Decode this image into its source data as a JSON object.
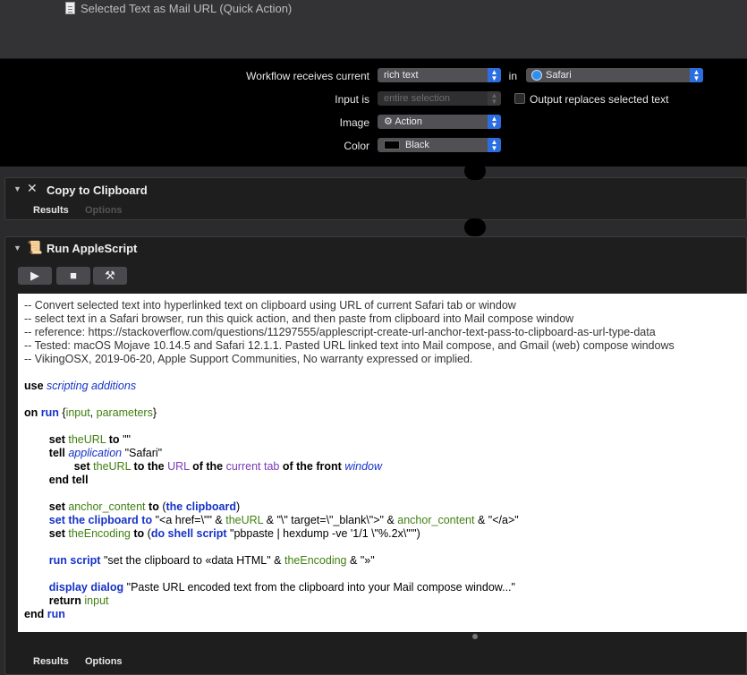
{
  "window": {
    "title": "Selected Text as Mail URL (Quick Action)"
  },
  "settings": {
    "receives_label": "Workflow receives current",
    "receives_value": "rich text",
    "in_label": "in",
    "app_value": "Safari",
    "input_label": "Input is",
    "input_value": "entire selection",
    "output_replaces_label": "Output replaces selected text",
    "image_label": "Image",
    "image_value": "Action",
    "color_label": "Color",
    "color_value": "Black"
  },
  "actions": {
    "copy": {
      "name": "Copy to Clipboard",
      "results_tab": "Results",
      "options_tab": "Options"
    },
    "script": {
      "name": "Run AppleScript",
      "results_tab": "Results",
      "options_tab": "Options"
    }
  },
  "toolbar": {
    "run_glyph": "▶",
    "stop_glyph": "■",
    "compile_glyph": "⚒"
  },
  "code": {
    "l1": "-- Convert selected text into hyperlinked text on clipboard using URL of current Safari tab or window",
    "l2": "-- select text in a Safari browser, run this quick action, and then paste from clipboard into Mail compose window",
    "l3": "-- reference: https://stackoverflow.com/questions/11297555/applescript-create-url-anchor-text-pass-to-clipboard-as-url-type-data",
    "l4": "-- Tested: macOS Mojave 10.14.5 and Safari 12.1.1. Pasted URL linked text into Mail compose, and Gmail (web) compose windows",
    "l5": "-- VikingOSX, 2019-06-20, Apple Support Communities, No warranty expressed or implied.",
    "use": "use",
    "scripting_additions": "scripting additions",
    "on": "on",
    "run": "run",
    "input": "input",
    "parameters": "parameters",
    "set": "set",
    "theURL": "theURL",
    "to": "to",
    "empty_str": "\"\"",
    "tell": "tell",
    "application": "application",
    "safari_str": "\"Safari\"",
    "to_the": "to the",
    "URL": "URL",
    "of_the": "of the",
    "current_tab": "current tab",
    "of_the_front": "of the front",
    "window": "window",
    "end": "end",
    "tell_kw": "tell",
    "anchor_content": "anchor_content",
    "the_clipboard": "the clipboard",
    "set_the_clipboard_to": "set the clipboard to",
    "href_str": "\"<a href=\\\"\"",
    "amp": "&",
    "target_str": "\"\\\" target=\\\"_blank\\\">\"",
    "close_str": "\"</a>\"",
    "theEncoding": "theEncoding",
    "do_shell_script": "do shell script",
    "shell_str": "\"pbpaste | hexdump -ve '1/1 \\\"%.2x\\\"'\"",
    "run_script": "run script",
    "data_str": "\"set the clipboard to «data HTML\"",
    "chev_str": "\"»\"",
    "display_dialog": "display dialog",
    "dialog_str": "\"Paste URL encoded text from the clipboard into your Mail compose window...\"",
    "return": "return",
    "end_run": "run"
  }
}
